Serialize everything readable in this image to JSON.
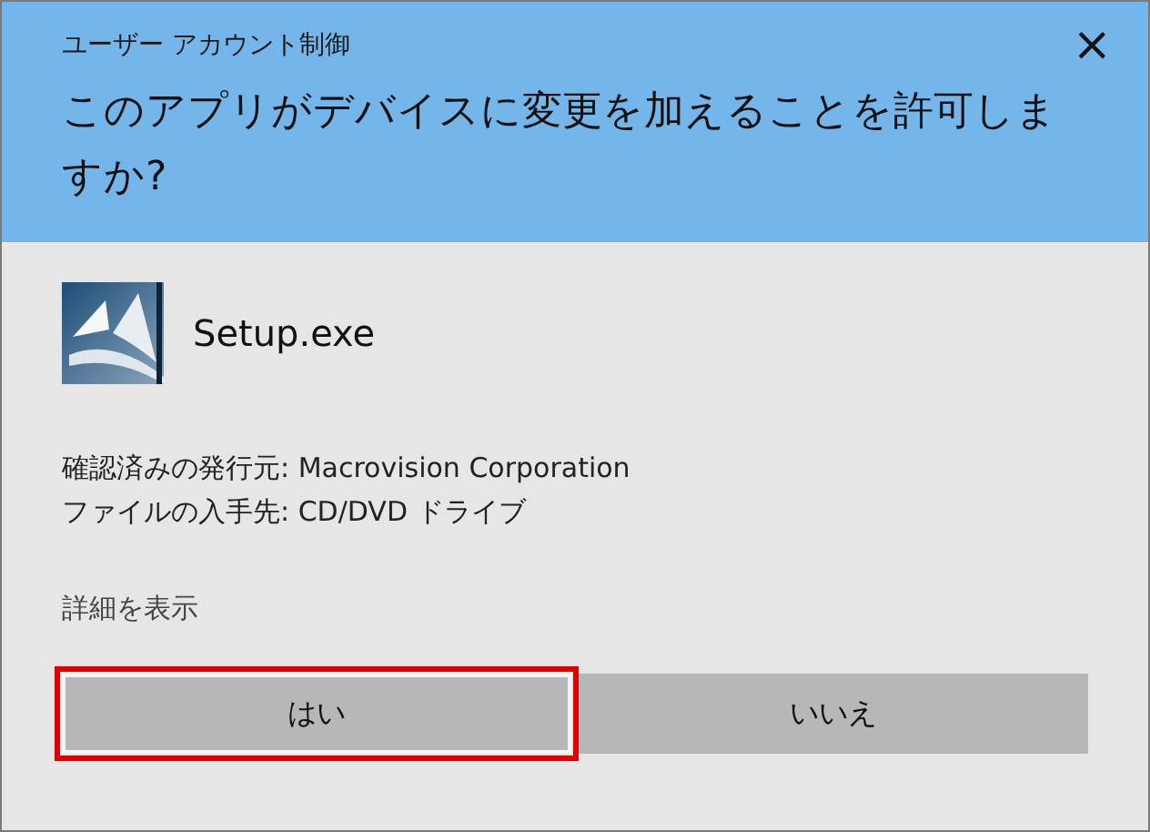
{
  "window": {
    "title": "ユーザー アカウント制御",
    "close": "×"
  },
  "question": "このアプリがデバイスに変更を加えることを許可しますか?",
  "app": {
    "name": "Setup.exe"
  },
  "details": [
    "確認済みの発行元: Macrovision Corporation",
    "ファイルの入手先: CD/DVD ドライブ"
  ],
  "more_link": "詳細を表示",
  "buttons": [
    {
      "label": "はい",
      "highlighted": true
    },
    {
      "label": "いいえ",
      "highlighted": false
    }
  ]
}
